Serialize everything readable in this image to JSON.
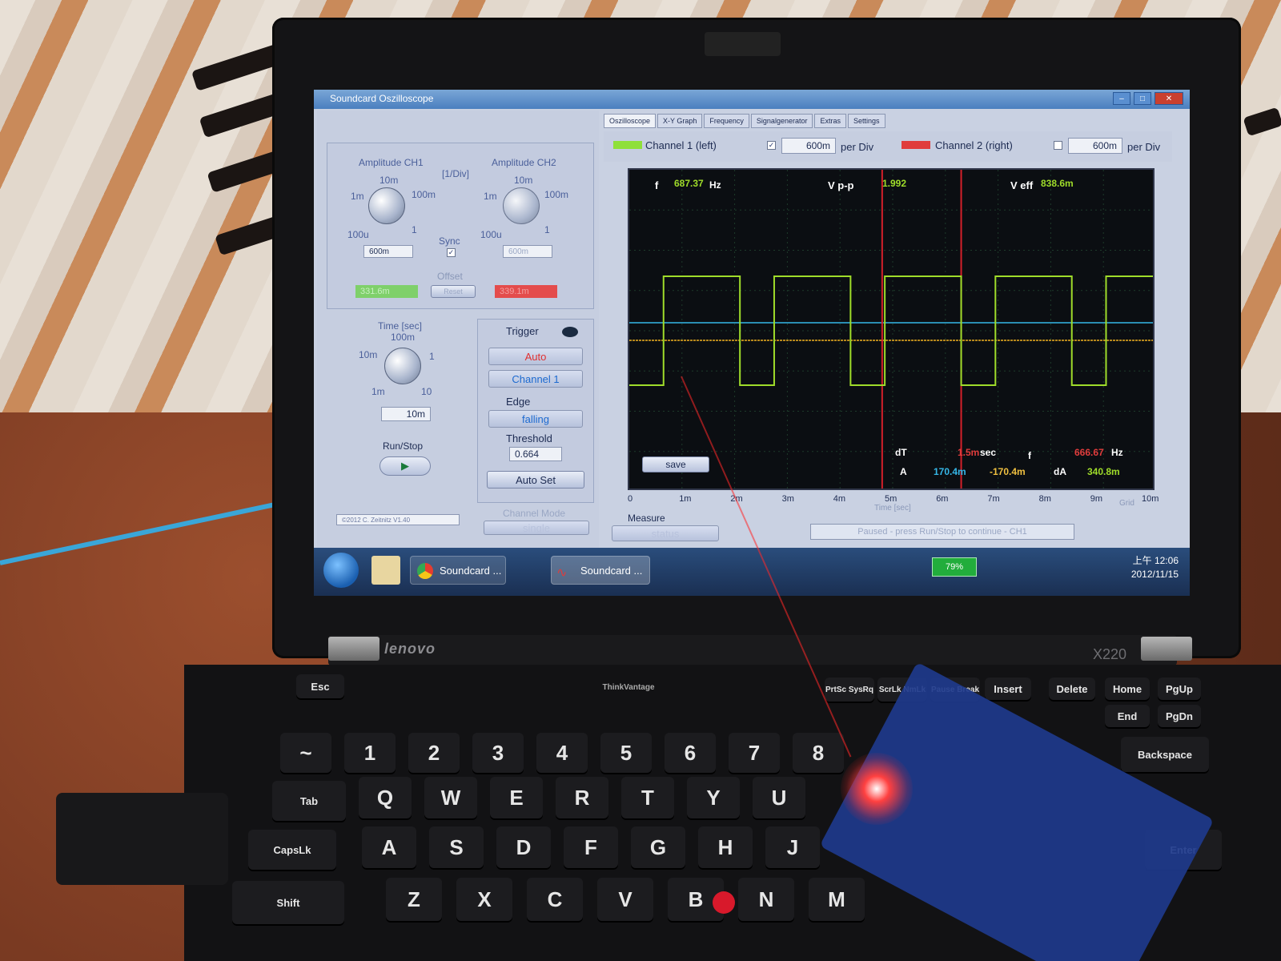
{
  "window": {
    "title": "Soundcard Oszilloscope"
  },
  "tabs": [
    "Oszilloscope",
    "X-Y Graph",
    "Frequency",
    "Signalgenerator",
    "Extras",
    "Settings"
  ],
  "amplitude": {
    "ch1_label": "Amplitude CH1",
    "ch2_label": "Amplitude CH2",
    "unit_label": "[1/Div]",
    "scale_10m": "10m",
    "scale_1m": "1m",
    "scale_100m": "100m",
    "scale_100u": "100u",
    "scale_1": "1",
    "ch1_value": "600m",
    "ch2_value": "600m",
    "sync_label": "Sync",
    "offset_label": "Offset",
    "offset_ch1": "331.6m",
    "reset_label": "Reset",
    "offset_ch2": "339.1m"
  },
  "time": {
    "label": "Time [sec]",
    "scale_100m": "100m",
    "scale_10m": "10m",
    "scale_1": "1",
    "scale_1m": "1m",
    "scale_10": "10",
    "value": "10m",
    "run_stop_label": "Run/Stop"
  },
  "trigger": {
    "label": "Trigger",
    "mode": "Auto",
    "channel": "Channel 1",
    "edge_label": "Edge",
    "edge": "falling",
    "threshold_label": "Threshold",
    "threshold": "0.664",
    "auto_set_label": "Auto Set"
  },
  "channel_mode": {
    "label": "Channel Mode",
    "value": "single"
  },
  "copyright": "©2012 C. Zeitnitz V1.40",
  "channels": {
    "ch1_label": "Channel 1 (left)",
    "ch1_per_div": "600m",
    "ch2_label": "Channel 2 (right)",
    "ch2_per_div": "600m",
    "per_div_label": "per Div"
  },
  "readouts": {
    "f_label": "f",
    "f_value": "687.37",
    "f_unit": "Hz",
    "vpp_label": "V p-p",
    "vpp_value": "1.992",
    "veff_label": "V eff",
    "veff_value": "838.6m",
    "dt_label": "dT",
    "dt_value": "1.5m",
    "dt_unit": "sec",
    "f2_label": "f",
    "f2_value": "666.67",
    "f2_unit": "Hz",
    "a_label": "A",
    "a1_value": "170.4m",
    "a2_value": "-170.4m",
    "da_label": "dA",
    "da_value": "340.8m",
    "save_label": "save"
  },
  "time_axis": {
    "ticks": [
      "0",
      "1m",
      "2m",
      "3m",
      "4m",
      "5m",
      "6m",
      "7m",
      "8m",
      "9m",
      "10m"
    ],
    "label": "Time [sec]",
    "grid_label": "Grid"
  },
  "measure": {
    "label": "Measure",
    "value": "status"
  },
  "status_text": "Paused - press Run/Stop to continue - CH1",
  "taskbar": {
    "item1": "Soundcard ...",
    "item2": "Soundcard ...",
    "battery": "79%",
    "time": "上午 12:06",
    "date": "2012/11/15"
  },
  "laptop": {
    "brand": "lenovo",
    "model": "X220",
    "thinkvantage": "ThinkVantage"
  },
  "keys": {
    "esc": "Esc",
    "tab": "Tab",
    "caps": "CapsLk",
    "shift": "Shift",
    "backspace": "Backspace",
    "enter": "Enter",
    "delete": "Delete",
    "home": "Home",
    "pgup": "PgUp",
    "end": "End",
    "pgdn": "PgDn",
    "insert": "Insert",
    "prtsc": "PrtSc SysRq",
    "scrlk": "ScrLk NmLk",
    "pause": "Pause Break",
    "row_num": [
      "~",
      "1",
      "2",
      "3",
      "4",
      "5",
      "6",
      "7",
      "8"
    ],
    "row_q": [
      "Q",
      "W",
      "E",
      "R",
      "T",
      "Y",
      "U"
    ],
    "row_a": [
      "A",
      "S",
      "D",
      "F",
      "G",
      "H",
      "J"
    ],
    "row_z": [
      "Z",
      "X",
      "C",
      "V",
      "B",
      "N",
      "M"
    ]
  },
  "colors": {
    "ch1": "#9fdc2a",
    "ch2": "#e03c3c",
    "cursor": "#d4202a",
    "trigger": "#f0b020",
    "offset": "#35b7e8"
  },
  "chart_data": {
    "type": "line",
    "x_unit": "sec",
    "xlim": [
      0,
      0.01
    ],
    "series": [
      {
        "name": "Channel 1 (left)",
        "x": [
          0,
          0.00065,
          0.00065,
          0.0021,
          0.0021,
          0.00275,
          0.00275,
          0.0042,
          0.0042,
          0.00485,
          0.00485,
          0.0063,
          0.0063,
          0.00695,
          0.00695,
          0.0084,
          0.0084,
          0.00905,
          0.00905,
          0.01
        ],
        "y": [
          -1,
          -1,
          1,
          1,
          -1,
          -1,
          1,
          1,
          -1,
          -1,
          1,
          1,
          -1,
          -1,
          1,
          1,
          -1,
          -1,
          1,
          1
        ]
      }
    ],
    "cursors_x": [
      0.0048,
      0.0063
    ]
  }
}
